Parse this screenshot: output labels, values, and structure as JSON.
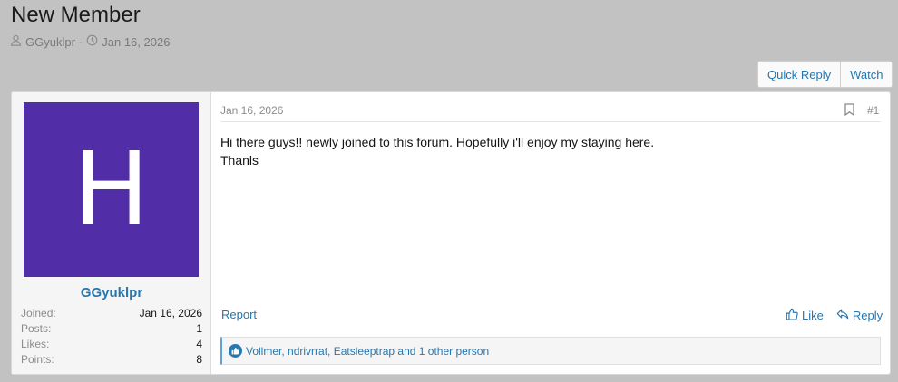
{
  "thread": {
    "title": "New Member",
    "author": "GGyuklpr",
    "separator": "·",
    "date": "Jan 16, 2026"
  },
  "actions": {
    "quick_reply": "Quick Reply",
    "watch": "Watch"
  },
  "user": {
    "avatar_letter": "H",
    "avatar_color": "#512da8",
    "name": "GGyuklpr",
    "stats": [
      {
        "label": "Joined:",
        "value": "Jan 16, 2026"
      },
      {
        "label": "Posts:",
        "value": "1"
      },
      {
        "label": "Likes:",
        "value": "4"
      },
      {
        "label": "Points:",
        "value": "8"
      }
    ]
  },
  "post": {
    "date": "Jan 16, 2026",
    "number": "#1",
    "body_line1": "Hi there guys!! newly joined to this forum. Hopefully i'll enjoy my staying here.",
    "body_line2": "Thanls",
    "report": "Report",
    "like": "Like",
    "reply": "Reply",
    "reactions_text": "Vollmer, ndrivrrat, Eatsleeptrap and 1 other person"
  },
  "colors": {
    "link": "#2577b1",
    "background": "#c2c2c2"
  }
}
